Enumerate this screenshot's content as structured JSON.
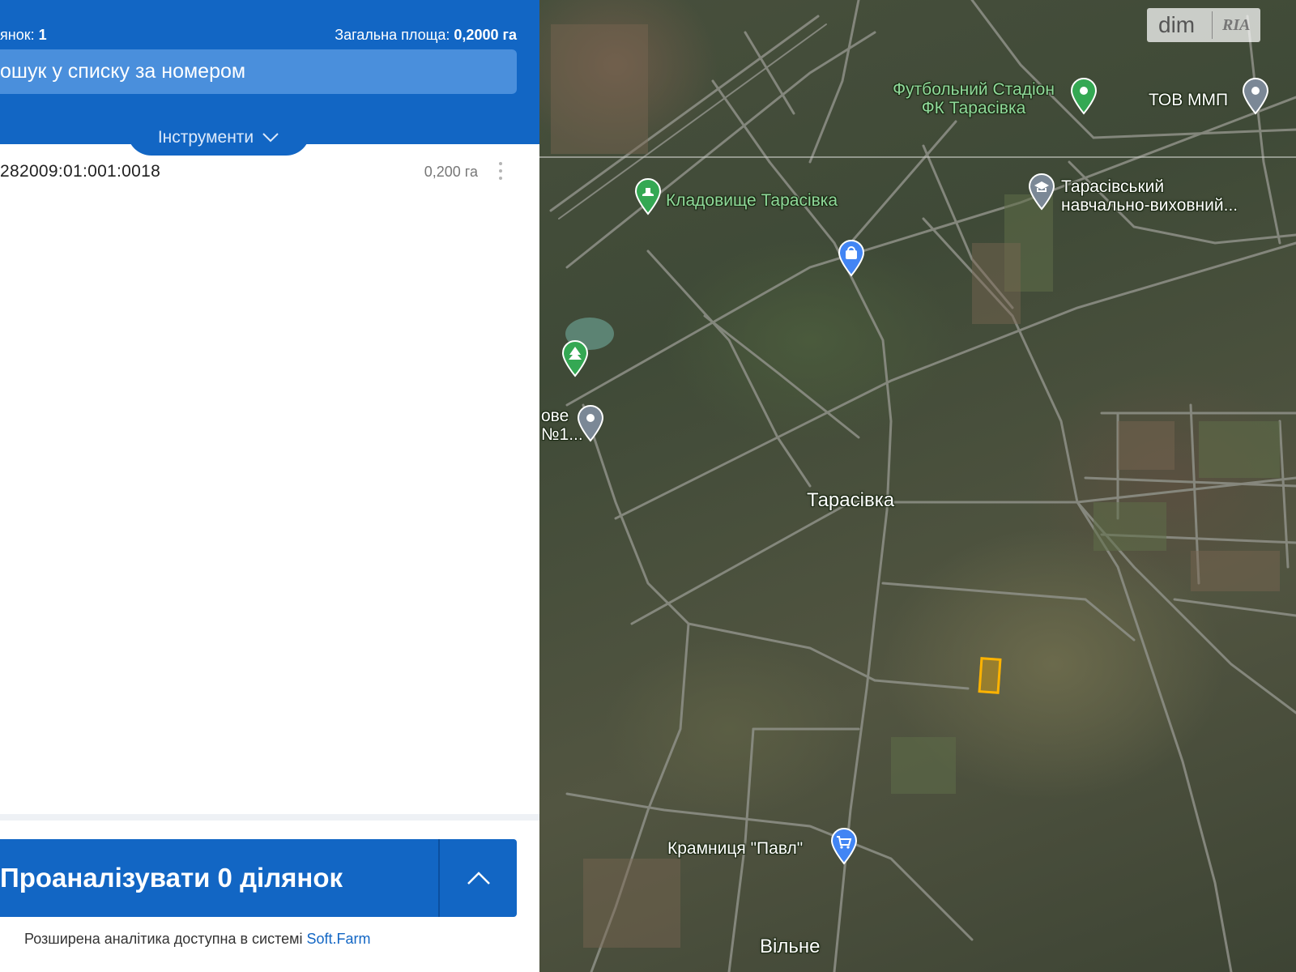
{
  "panel": {
    "count_prefix": "янок: ",
    "count_value": "1",
    "area_prefix": "Загальна площа: ",
    "area_value": "0,2000 га",
    "search_placeholder": "ошук у списку за номером",
    "tools_label": "Інструменти",
    "parcels": [
      {
        "id": "282009:01:001:0018",
        "area": "0,200 га"
      }
    ],
    "analyze_label": "Проаналізувати 0 ділянок",
    "footer_text": "Розширена аналітика доступна в системі ",
    "footer_link": "Soft.Farm"
  },
  "map": {
    "watermark": {
      "dim": "dim",
      "ria": "RIA"
    },
    "labels": {
      "stadium_line1": "Футбольний Стадіон",
      "stadium_line2": "ФК Тарасівка",
      "company": "ТОВ ММП",
      "school_line1": "Тарасівський",
      "school_line2": "навчально-виховний...",
      "cemetery": "Кладовище Тарасівка",
      "partial_line1": "ове",
      "partial_line2": "№1...",
      "village": "Тарасівка",
      "shop": "Крамниця \"Павл\"",
      "village2": "Вільне"
    },
    "colors": {
      "green_pin": "#34a853",
      "blue_pin": "#4285f4",
      "gray_pin": "#7b8896",
      "parcel": "#ffb300"
    },
    "icons": [
      "park-pin-icon",
      "shopping-pin-icon",
      "school-pin-icon",
      "location-pin-icon",
      "cemetery-pin-icon",
      "cart-pin-icon"
    ]
  }
}
